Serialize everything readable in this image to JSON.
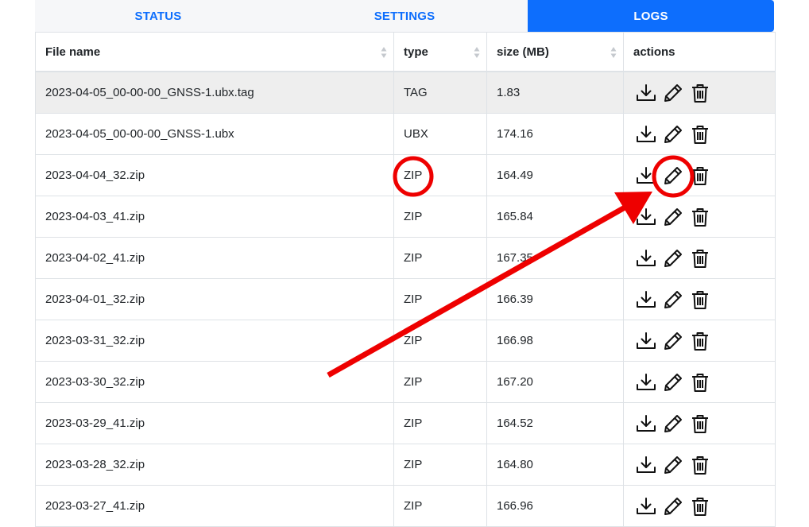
{
  "tabs": [
    {
      "label": "STATUS",
      "active": false
    },
    {
      "label": "SETTINGS",
      "active": false
    },
    {
      "label": "LOGS",
      "active": true
    }
  ],
  "table": {
    "columns": [
      "File name",
      "type",
      "size (MB)",
      "actions"
    ],
    "rows": [
      {
        "name": "2023-04-05_00-00-00_GNSS-1.ubx.tag",
        "type": "TAG",
        "size": "1.83",
        "highlighted": true
      },
      {
        "name": "2023-04-05_00-00-00_GNSS-1.ubx",
        "type": "UBX",
        "size": "174.16"
      },
      {
        "name": "2023-04-04_32.zip",
        "type": "ZIP",
        "size": "164.49"
      },
      {
        "name": "2023-04-03_41.zip",
        "type": "ZIP",
        "size": "165.84"
      },
      {
        "name": "2023-04-02_41.zip",
        "type": "ZIP",
        "size": "167.35"
      },
      {
        "name": "2023-04-01_32.zip",
        "type": "ZIP",
        "size": "166.39"
      },
      {
        "name": "2023-03-31_32.zip",
        "type": "ZIP",
        "size": "166.98"
      },
      {
        "name": "2023-03-30_32.zip",
        "type": "ZIP",
        "size": "167.20"
      },
      {
        "name": "2023-03-29_41.zip",
        "type": "ZIP",
        "size": "164.52"
      },
      {
        "name": "2023-03-28_32.zip",
        "type": "ZIP",
        "size": "164.80"
      },
      {
        "name": "2023-03-27_41.zip",
        "type": "ZIP",
        "size": "166.96"
      }
    ],
    "row_actions": [
      "download-icon",
      "pencil-icon",
      "trash-icon"
    ]
  },
  "annotations": {
    "color": "#ee0000",
    "circle_type_row": 2,
    "circle_edit_row": 2,
    "arrow_target": "edit icon in row 3"
  },
  "colors": {
    "accent": "#0d6efd",
    "highlight_row": "#eeeeee",
    "border": "#dee2e6"
  }
}
